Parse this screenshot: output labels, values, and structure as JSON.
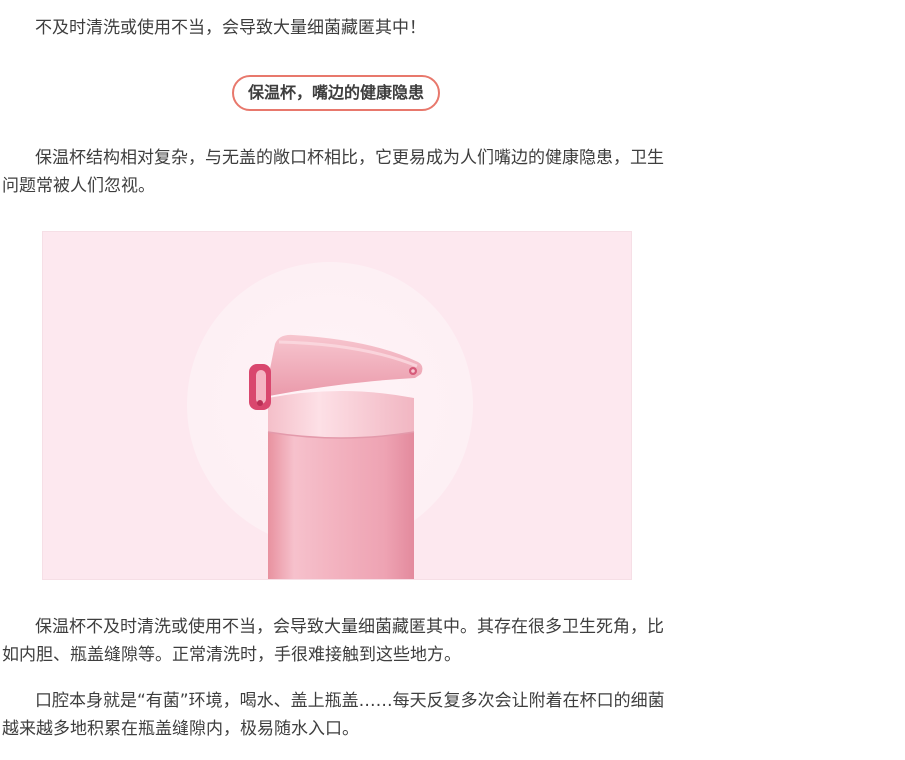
{
  "article": {
    "intro": "不及时清洗或使用不当，会导致大量细菌藏匿其中！",
    "section_heading": "保温杯，嘴边的健康隐患",
    "paragraph_1": "保温杯结构相对复杂，与无盖的敞口杯相比，它更易成为人们嘴边的健康隐患，卫生问题常被人们忽视。",
    "paragraph_2": "保温杯不及时清洗或使用不当，会导致大量细菌藏匿其中。其存在很多卫生死角，比如内胆、瓶盖缝隙等。正常清洗时，手很难接触到这些地方。",
    "paragraph_3": "口腔本身就是“有菌”环境，喝水、盖上瓶盖……每天反复多次会让附着在杯口的细菌越来越多地积累在瓶盖缝隙内，极易随水入口。"
  },
  "colors": {
    "text": "#3e3e3e",
    "heading_border": "#e8786c",
    "figure_background": "#fde8ef",
    "bottle_pink": "#f2aebd",
    "lid_accent": "#d9476e"
  },
  "icons": {
    "figure": "thermos-bottle-photo"
  }
}
